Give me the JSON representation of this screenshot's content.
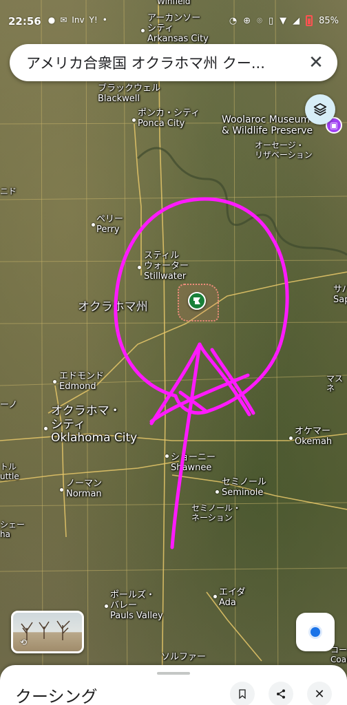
{
  "status_bar": {
    "time": "22:56",
    "left_icons": [
      "line-icon",
      "mail-icon",
      "inv-icon",
      "yahoo-icon",
      "dot-icon"
    ],
    "yahoo_text": "Y!",
    "inv_text": "Inv",
    "right_icons": [
      "alarm-icon",
      "data-saver-icon",
      "location-icon",
      "vibrate-icon",
      "wifi-icon",
      "signal-icon",
      "battery-icon"
    ],
    "battery": "85%"
  },
  "search": {
    "query": "アメリカ合衆国 オクラホマ州 クー..."
  },
  "map": {
    "labels": {
      "winfield": "Winfield",
      "arkansas_jp_1": "アーカンソー",
      "arkansas_jp_2": "シティ",
      "arkansas_en": "Arkansas City",
      "blackwell_jp": "ブラックウェル",
      "blackwell_en": "Blackwell",
      "ponca_jp": "ポンカ・シティ",
      "ponca_en": "Ponca City",
      "woolaroc_1": "Woolaroc Museum",
      "woolaroc_2": "& Wildlife Preserve",
      "osage_1": "オーセージ・",
      "osage_2": "リザベーション",
      "nido": "ニド",
      "perry_jp": "ペリー",
      "perry_en": "Perry",
      "stillwater_jp_1": "スティル",
      "stillwater_jp_2": "ウォーター",
      "stillwater_en": "Stillwater",
      "oklahoma_state": "オクラホマ州",
      "sapulpa_jp": "サパ",
      "sapulpa_en": "Sap",
      "edmond_jp": "エドモンド",
      "edmond_en": "Edmond",
      "okc_jp_1": "オクラホマ・",
      "okc_jp_2": "シティ",
      "okc_en": "Oklahoma City",
      "mus_jp": "マス",
      "mus_jp2": "ネ",
      "okemah_jp": "オケマー",
      "okemah_en": "Okemah",
      "shawnee_jp": "ショーニー",
      "shawnee_en": "Shawnee",
      "seminole_jp": "セミノール",
      "seminole_en": "Seminole",
      "seminole_nation_1": "セミノール・",
      "seminole_nation_2": "ネーション",
      "norman_jp": "ノーマン",
      "norman_en": "Norman",
      "ttle_jp": "トル",
      "ttle_en": "uttle",
      "she_jp": "シェー",
      "she_en": "ha",
      "pauls_jp_1": "ポールズ・",
      "pauls_jp_2": "バレー",
      "pauls_en": "Pauls Valley",
      "ada_jp": "エイダ",
      "ada_en": "Ada",
      "sulphur_jp": "ソルファー",
      "coalgate_jp": "コールゲ",
      "coalgate_en": "Coalgate",
      "o_jp": "ーノ"
    }
  },
  "thumbnail": {
    "pano_icon": "360-icon"
  },
  "sheet": {
    "title": "クーシング"
  },
  "colors": {
    "annotation": "#ff1aff",
    "pin": "#188038",
    "area": "#f08d7c",
    "locate": "#1a73e8"
  }
}
